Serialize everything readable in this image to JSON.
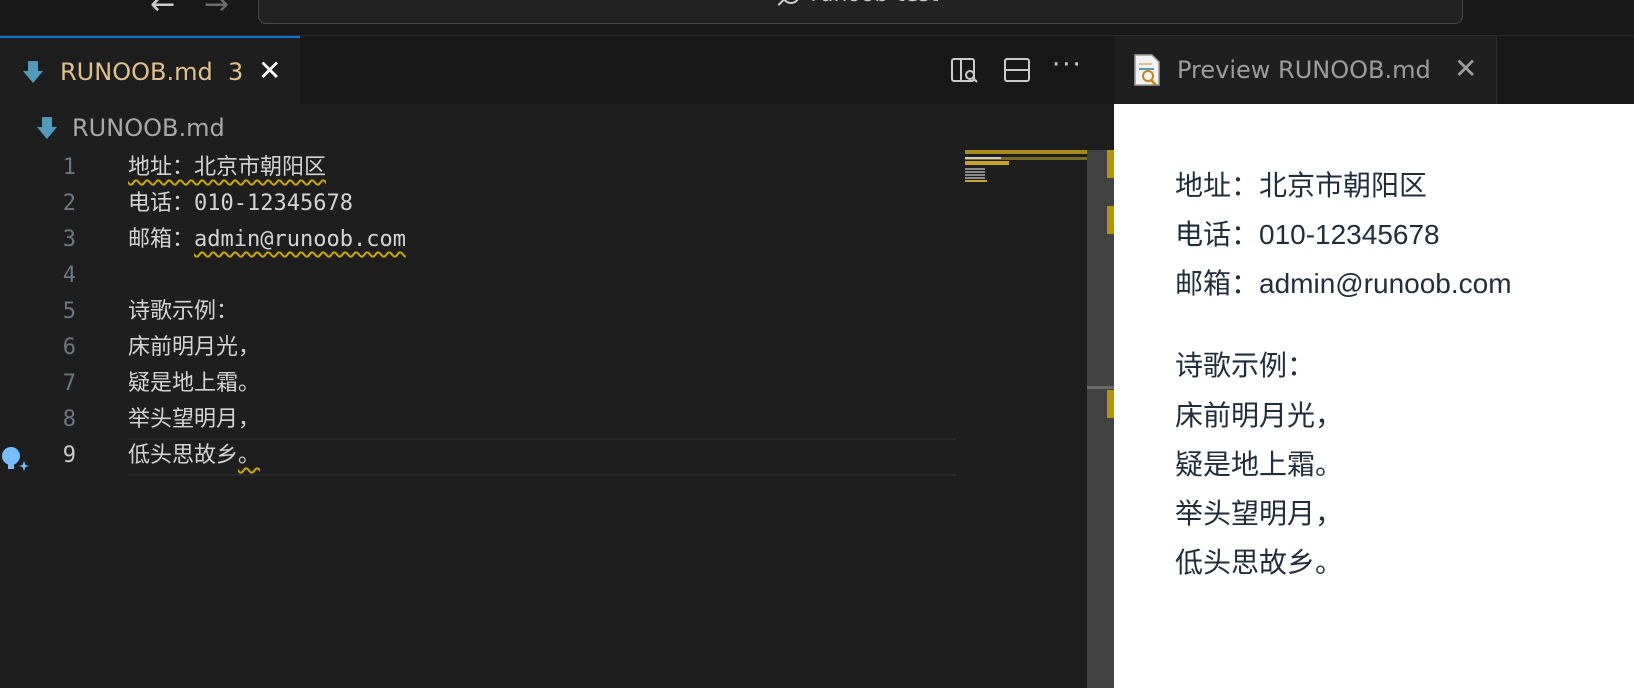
{
  "titlebar": {
    "search_text": "runoob-test"
  },
  "editor_tab": {
    "title": "RUNOOB.md",
    "problem_count": "3",
    "close_glyph": "✕",
    "more_glyph": "···"
  },
  "breadcrumb": {
    "file": "RUNOOB.md"
  },
  "editor": {
    "lines": [
      {
        "num": "1",
        "text": "地址：北京市朝阳区"
      },
      {
        "num": "2",
        "text": "电话：010-12345678"
      },
      {
        "num": "3",
        "label": "邮箱：",
        "link": "admin@runoob.com"
      },
      {
        "num": "4",
        "text": ""
      },
      {
        "num": "5",
        "text": "诗歌示例："
      },
      {
        "num": "6",
        "text": "床前明月光，"
      },
      {
        "num": "7",
        "text": "疑是地上霜。"
      },
      {
        "num": "8",
        "text": "举头望明月，"
      },
      {
        "num": "9",
        "text": "低头思故乡",
        "tail": "。"
      }
    ],
    "active_line": "9"
  },
  "preview_tab": {
    "title": "Preview RUNOOB.md",
    "close_glyph": "✕"
  },
  "preview": {
    "lines": [
      "地址：北京市朝阳区",
      "电话：010-12345678",
      "邮箱：admin@runoob.com",
      "诗歌示例：",
      "床前明月光，",
      "疑是地上霜。",
      "举头望明月，",
      "低头思故乡。"
    ]
  },
  "icons": {
    "back": "back-arrow-icon",
    "forward": "forward-arrow-icon",
    "search": "search-icon",
    "markdown": "markdown-file-icon",
    "open_preview": "open-preview-to-side-icon",
    "split": "split-editor-icon",
    "more": "more-actions-icon",
    "preview_file": "preview-file-icon",
    "lightbulb": "lightbulb-sparkle-icon"
  },
  "colors": {
    "warning": "#cca700",
    "tab_modified": "#e2c08d",
    "active_border": "#0078d4",
    "editor_bg": "#1e1e1e",
    "preview_bg": "#ffffff"
  }
}
